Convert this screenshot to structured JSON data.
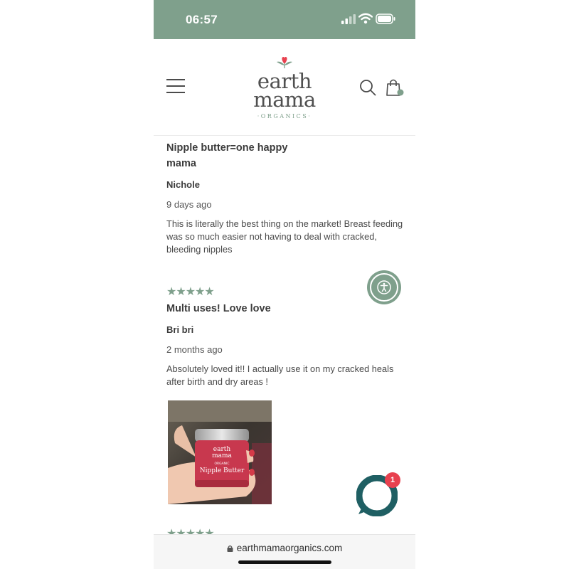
{
  "status_bar": {
    "time": "06:57"
  },
  "header": {
    "logo": {
      "line1": "earth",
      "line2": "mama",
      "line3": "·ORGANICS·"
    },
    "icons": {
      "menu": "hamburger-menu-icon",
      "search": "search-icon",
      "cart": "shopping-bag-icon"
    }
  },
  "colors": {
    "accent": "#7fa08c",
    "brand_red": "#e8414f",
    "chat": "#1f5f63"
  },
  "reviews": [
    {
      "title": "Nipple butter=one happy mama",
      "author": "Nichole",
      "date": "9 days ago",
      "body": "This is literally the best thing on the market! Breast feeding was so much easier not having to deal with cracked, bleeding nipples"
    },
    {
      "rating": "5 stars",
      "stars": "★★★★★",
      "title": "Multi uses! Love love",
      "author": "Bri bri",
      "date": "2 months ago",
      "body": "Absolutely loved it!! I actually use it on my cracked heals after birth and dry areas !",
      "photo": {
        "jar_brand_line1": "earth",
        "jar_brand_line2": "mama",
        "jar_label_small": "ORGANIC",
        "jar_product": "Nipple Butter"
      }
    },
    {
      "stars": "★★★★★"
    }
  ],
  "chat": {
    "badge_count": "1"
  },
  "browser": {
    "url": "earthmamaorganics.com"
  }
}
